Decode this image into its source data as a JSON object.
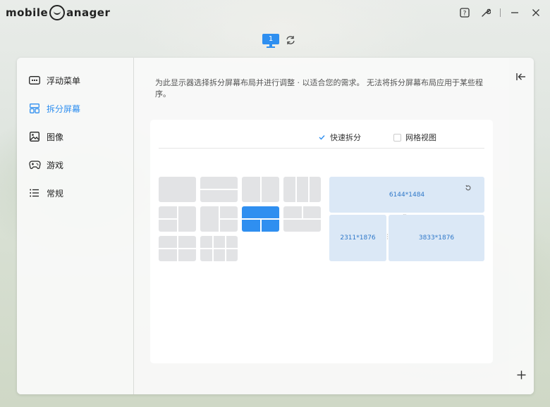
{
  "app": {
    "logo_text_prefix": "mobile",
    "logo_text_suffix": "anager"
  },
  "window_controls": {
    "help_icon": "help-icon",
    "settings_icon": "wrench-icon",
    "minimize_icon": "minimize-icon",
    "close_icon": "close-icon"
  },
  "monitor": {
    "number": "1"
  },
  "sidebar": {
    "items": [
      {
        "label": "浮动菜单",
        "icon": "dots-icon",
        "active": false
      },
      {
        "label": "拆分屏幕",
        "icon": "split-layout-icon",
        "active": true
      },
      {
        "label": "图像",
        "icon": "image-icon",
        "active": false
      },
      {
        "label": "游戏",
        "icon": "gamepad-icon",
        "active": false
      },
      {
        "label": "常规",
        "icon": "list-icon",
        "active": false
      }
    ]
  },
  "main": {
    "description": "为此显示器选择拆分屏幕布局并进行调整 · 以适合您的需求。 无法将拆分屏幕布局应用于某些程序。",
    "options": {
      "quick_split": {
        "label": "快速拆分",
        "checked": true
      },
      "grid_view": {
        "label": "网格视图",
        "checked": false
      }
    },
    "preview": {
      "top": "6144*1484",
      "bottom_left": "2311*1876",
      "bottom_right": "3833*1876"
    }
  },
  "colors": {
    "accent": "#2f8ff0",
    "tile": "#e2e3e5",
    "preview_zone": "#dbe8f6"
  }
}
